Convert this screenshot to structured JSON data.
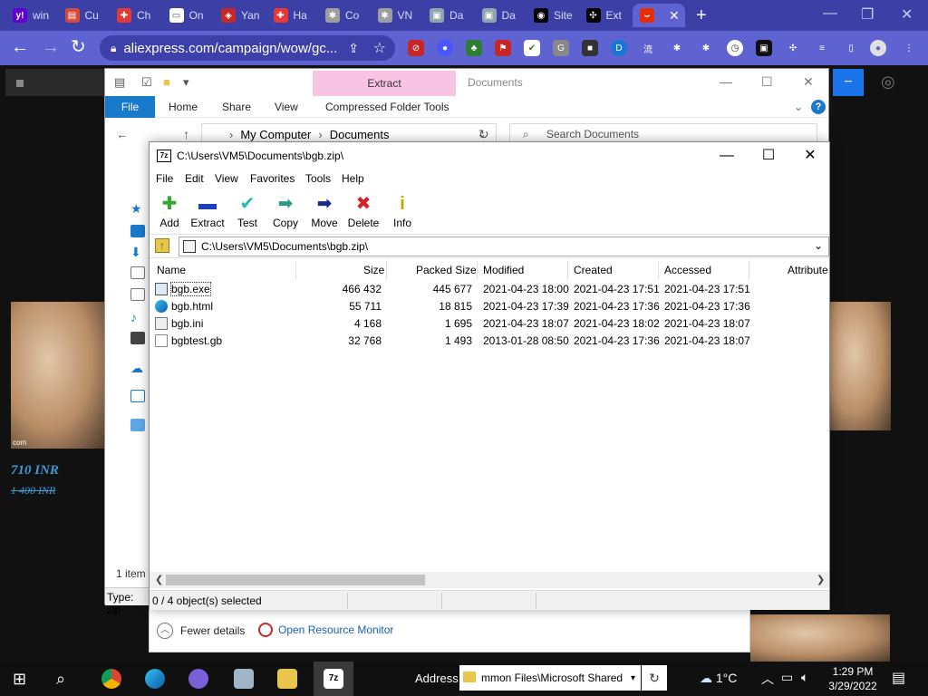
{
  "browser": {
    "tabs": [
      {
        "label": "win",
        "icon": "yahoo-icon",
        "color": "#6001d2",
        "glyph": "y!"
      },
      {
        "label": "Cu",
        "icon": "shopping-cart-icon",
        "color": "#d54a3b",
        "glyph": "▤"
      },
      {
        "label": "Ch",
        "icon": "swiss-cross-icon",
        "color": "#e53935",
        "glyph": "✚"
      },
      {
        "label": "On",
        "icon": "document-icon",
        "color": "#ffffff",
        "glyph": "▭"
      },
      {
        "label": "Yan",
        "icon": "antivirus-icon",
        "color": "#c62828",
        "glyph": "◈"
      },
      {
        "label": "Ha",
        "icon": "swiss-cross-icon",
        "color": "#e53935",
        "glyph": "✚"
      },
      {
        "label": "Co",
        "icon": "bug-icon",
        "color": "#9e9e9e",
        "glyph": "✱"
      },
      {
        "label": "VN",
        "icon": "bug-icon",
        "color": "#9e9e9e",
        "glyph": "✱"
      },
      {
        "label": "Da",
        "icon": "page-icon",
        "color": "#90a4ae",
        "glyph": "▣"
      },
      {
        "label": "Da",
        "icon": "page-icon",
        "color": "#90a4ae",
        "glyph": "▣"
      },
      {
        "label": "Site",
        "icon": "globe-icon",
        "color": "#000000",
        "glyph": "◉"
      },
      {
        "label": "Ext",
        "icon": "puzzle-icon",
        "color": "#000000",
        "glyph": "✣"
      }
    ],
    "active_tab": {
      "icon": "aliexpress-icon",
      "color": "#e62e04",
      "glyph": "⌣",
      "close": "✕"
    },
    "new_tab": "+",
    "url": "aliexpress.com/campaign/wow/gc...",
    "accent": "#5f63d1"
  },
  "page": {
    "price": "710 INR",
    "old_price": "1 400 INR",
    "photo_caption": "com"
  },
  "explorer": {
    "qat_extract": "Extract",
    "window_title": "Documents",
    "ribbon_tabs": [
      "File",
      "Home",
      "Share",
      "View",
      "Compressed Folder Tools"
    ],
    "breadcrumb": [
      "My Computer",
      "Documents"
    ],
    "search_placeholder": "Search Documents",
    "status": "1 item",
    "bottom_status": "Type: zip"
  },
  "taskmgr": {
    "fewer_details": "Fewer details",
    "open_resource_monitor": "Open Resource Monitor"
  },
  "sevenzip": {
    "title": "C:\\Users\\VM5\\Documents\\bgb.zip\\",
    "menu": [
      "File",
      "Edit",
      "View",
      "Favorites",
      "Tools",
      "Help"
    ],
    "tools": [
      {
        "label": "Add",
        "icon": "add-icon",
        "glyph": "✚",
        "color": "#2eaa2e"
      },
      {
        "label": "Extract",
        "icon": "extract-icon",
        "glyph": "▬",
        "color": "#1b3fc4"
      },
      {
        "label": "Test",
        "icon": "test-icon",
        "glyph": "✔",
        "color": "#2bb6b6"
      },
      {
        "label": "Copy",
        "icon": "copy-icon",
        "glyph": "➡",
        "color": "#2a9a8a"
      },
      {
        "label": "Move",
        "icon": "move-icon",
        "glyph": "➡",
        "color": "#1a2a8a"
      },
      {
        "label": "Delete",
        "icon": "delete-icon",
        "glyph": "✖",
        "color": "#d32020"
      },
      {
        "label": "Info",
        "icon": "info-icon",
        "glyph": "i",
        "color": "#c9a400"
      }
    ],
    "path": "C:\\Users\\VM5\\Documents\\bgb.zip\\",
    "columns": [
      "Name",
      "Size",
      "Packed Size",
      "Modified",
      "Created",
      "Accessed",
      "Attribute"
    ],
    "files": [
      {
        "name": "bgb.exe",
        "size": "466 432",
        "packed": "445 677",
        "modified": "2021-04-23 18:00",
        "created": "2021-04-23 17:51",
        "accessed": "2021-04-23 17:51",
        "icon": "exe-file-icon"
      },
      {
        "name": "bgb.html",
        "size": "55 711",
        "packed": "18 815",
        "modified": "2021-04-23 17:39",
        "created": "2021-04-23 17:36",
        "accessed": "2021-04-23 17:36",
        "icon": "edge-html-icon"
      },
      {
        "name": "bgb.ini",
        "size": "4 168",
        "packed": "1 695",
        "modified": "2021-04-23 18:07",
        "created": "2021-04-23 18:02",
        "accessed": "2021-04-23 18:07",
        "icon": "ini-file-icon"
      },
      {
        "name": "bgbtest.gb",
        "size": "32 768",
        "packed": "1 493",
        "modified": "2013-01-28 08:50",
        "created": "2021-04-23 17:36",
        "accessed": "2021-04-23 18:07",
        "icon": "blank-file-icon"
      }
    ],
    "status": "0 / 4 object(s) selected"
  },
  "taskbar": {
    "address_label": "Address",
    "address_value": "mmon Files\\Microsoft Shared",
    "weather": "1°C",
    "time": "1:29 PM",
    "date": "3/29/2022"
  }
}
